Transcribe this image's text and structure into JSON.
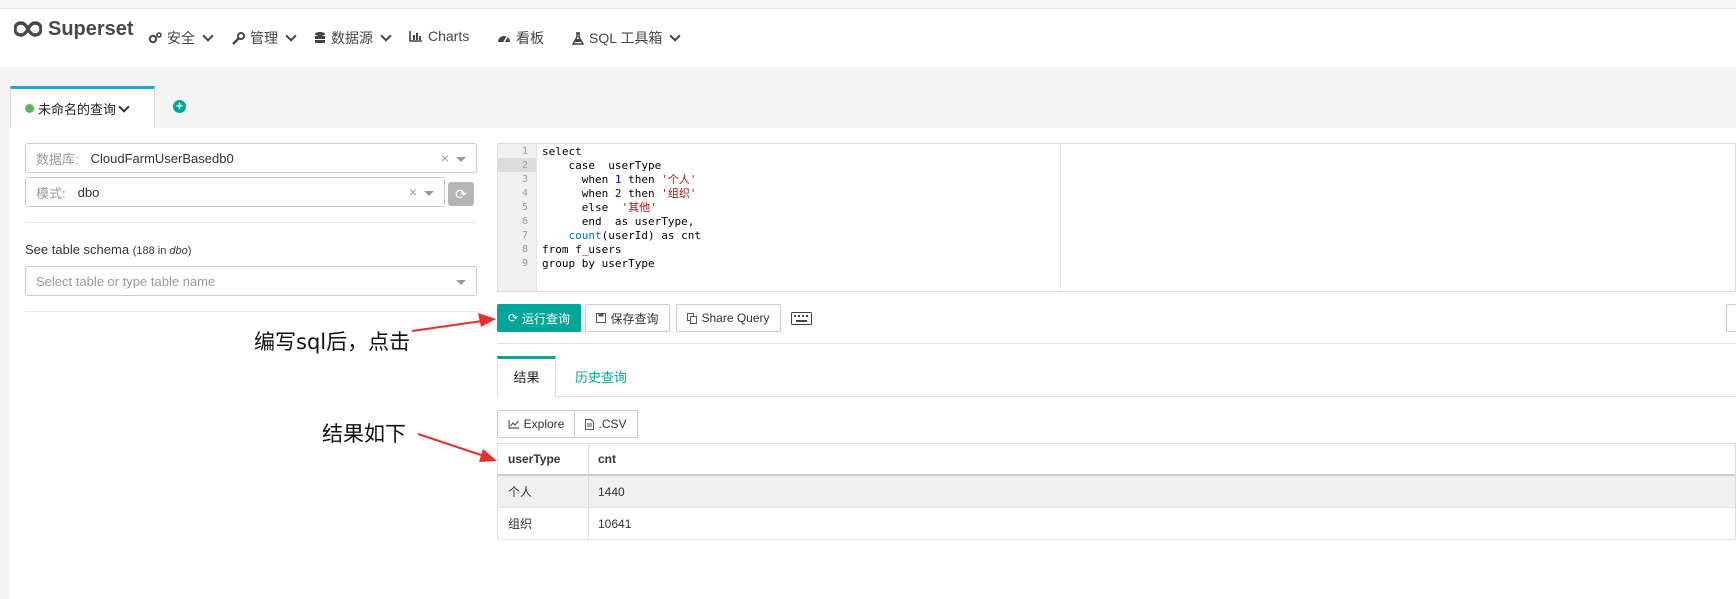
{
  "navbar": {
    "brand": "Superset",
    "items": [
      {
        "label": "安全",
        "icon": "gears-icon",
        "dropdown": true
      },
      {
        "label": "管理",
        "icon": "wrench-icon",
        "dropdown": true
      },
      {
        "label": "数据源",
        "icon": "database-icon",
        "dropdown": true
      },
      {
        "label": "Charts",
        "icon": "bar-chart-icon",
        "dropdown": false
      },
      {
        "label": "看板",
        "icon": "dashboard-icon",
        "dropdown": false
      },
      {
        "label": "SQL 工具箱",
        "icon": "flask-icon",
        "dropdown": true
      }
    ]
  },
  "query_tab": {
    "label": "未命名的查询",
    "status_color": "#5cb85c"
  },
  "left_panel": {
    "database": {
      "label": "数据库:",
      "value": "CloudFarmUserBasedb0"
    },
    "schema": {
      "label": "模式:",
      "value": "dbo"
    },
    "schema_title": "See table schema",
    "schema_count": "(188 in ",
    "schema_name": "dbo",
    "schema_close": ")",
    "table_placeholder": "Select table or type table name"
  },
  "editor": {
    "line_numbers": [
      "1",
      "2",
      "3",
      "4",
      "5",
      "6",
      "7",
      "8",
      "9"
    ],
    "lines": [
      "select",
      "    case  userType",
      "      when 1 then '个人'",
      "      when 2 then '组织'",
      "      else  '其他'",
      "      end  as userType,",
      "    count(userId) as cnt",
      "from f_users",
      "group by userType"
    ]
  },
  "toolbar": {
    "run_label": "运行查询",
    "save_label": "保存查询",
    "share_label": "Share Query"
  },
  "results": {
    "tab_results": "结果",
    "tab_history": "历史查询",
    "explore_label": "Explore",
    "csv_label": ".CSV",
    "columns": [
      "userType",
      "cnt"
    ],
    "rows": [
      [
        "个人",
        "1440"
      ],
      [
        "组织",
        "10641"
      ]
    ]
  },
  "annotations": {
    "run_hint": "编写sql后，点击",
    "result_hint": "结果如下"
  },
  "colors": {
    "accent": "#00a699",
    "arrow": "#e8302a"
  }
}
